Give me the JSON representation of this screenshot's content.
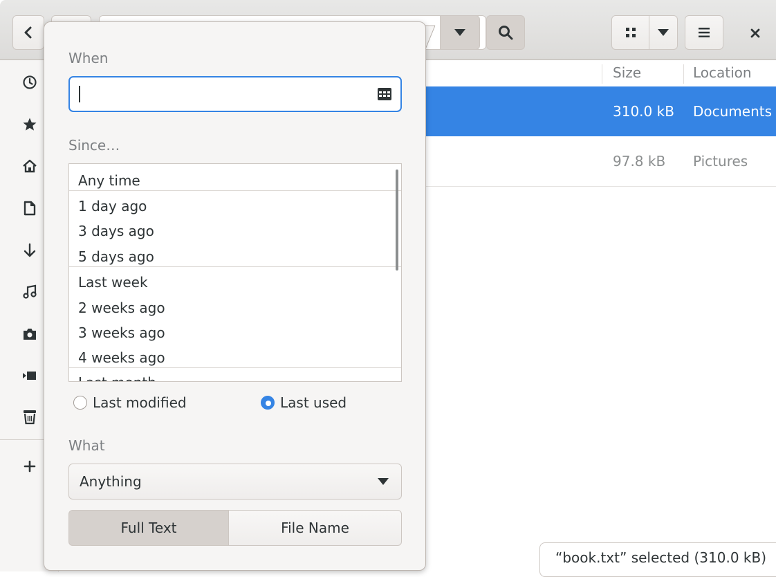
{
  "headerbar": {
    "back_icon": "chevron-left-icon",
    "search_icon": "search-icon",
    "view_icon": "grid-view-icon",
    "menu_icon": "hamburger-menu-icon",
    "close_icon": "close-icon"
  },
  "sidebar": {
    "items": [
      {
        "icon": "recent-clock-icon"
      },
      {
        "icon": "star-icon"
      },
      {
        "icon": "home-icon"
      },
      {
        "icon": "document-icon"
      },
      {
        "icon": "download-arrow-icon"
      },
      {
        "icon": "music-note-icon"
      },
      {
        "icon": "camera-icon"
      },
      {
        "icon": "video-icon"
      },
      {
        "icon": "trash-icon"
      },
      {
        "icon": "plus-icon"
      }
    ]
  },
  "list": {
    "columns": [
      "Size",
      "Location"
    ],
    "rows": [
      {
        "size": "310.0 kB",
        "location": "Documents",
        "selected": true
      },
      {
        "size": "97.8 kB",
        "location": "Pictures",
        "selected": false
      }
    ]
  },
  "status": {
    "text": "“book.txt” selected  (310.0 kB)"
  },
  "popover": {
    "when_label": "When",
    "when_value": "",
    "since_label": "Since…",
    "since_options": [
      "Any time",
      "1 day ago",
      "3 days ago",
      "5 days ago",
      "Last week",
      "2 weeks ago",
      "3 weeks ago",
      "4 weeks ago",
      "Last month"
    ],
    "radio_last_modified": "Last modified",
    "radio_last_used": "Last used",
    "radio_selected": "Last used",
    "what_label": "What",
    "what_value": "Anything",
    "full_text_label": "Full Text",
    "file_name_label": "File Name",
    "active_mode": "Full Text"
  },
  "colors": {
    "accent": "#3584e4",
    "sidebar_bg": "#f6f5f4",
    "text": "#2e3436"
  }
}
